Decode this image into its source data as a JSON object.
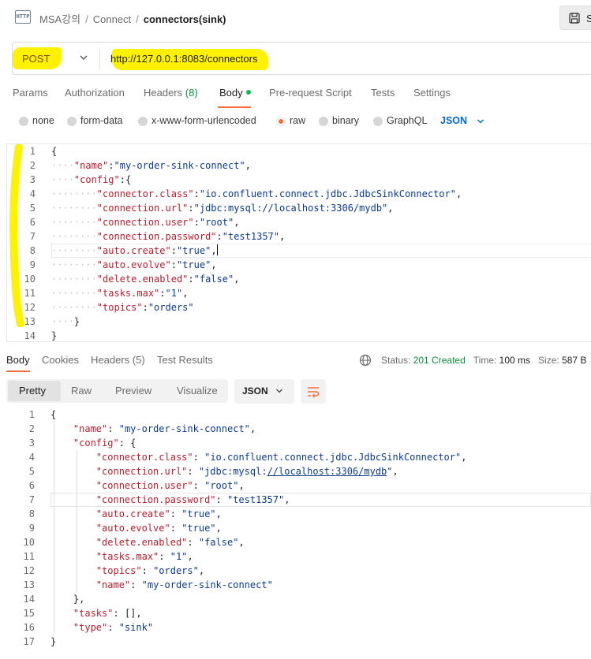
{
  "header": {
    "breadcrumb": [
      "MSA강의",
      "Connect",
      "connectors(sink)"
    ],
    "save_label": "S",
    "http_icon_text": "HTTP"
  },
  "request": {
    "method": "POST",
    "url": "http://127.0.0.1:8083/connectors"
  },
  "request_tabs": [
    {
      "label": "Params"
    },
    {
      "label": "Authorization"
    },
    {
      "label": "Headers",
      "count": "(8)"
    },
    {
      "label": "Body",
      "active": true
    },
    {
      "label": "Pre-request Script"
    },
    {
      "label": "Tests"
    },
    {
      "label": "Settings"
    }
  ],
  "body_types": [
    "none",
    "form-data",
    "x-www-form-urlencoded",
    "raw",
    "binary",
    "GraphQL"
  ],
  "body_type_selected": "raw",
  "body_format": "JSON",
  "request_body_lines": [
    "{",
    "····\"name\":\"my-order-sink-connect\",",
    "····\"config\":{",
    "········\"connector.class\":\"io.confluent.connect.jdbc.JdbcSinkConnector\",",
    "········\"connection.url\":\"jdbc:mysql://localhost:3306/mydb\",",
    "········\"connection.user\":\"root\",",
    "········\"connection.password\":\"test1357\",",
    "········\"auto.create\":\"true\",",
    "········\"auto.evolve\":\"true\",",
    "········\"delete.enabled\":\"false\",",
    "········\"tasks.max\":\"1\",",
    "········\"topics\":\"orders\"",
    "····}",
    "}"
  ],
  "response_tabs": [
    {
      "label": "Body",
      "active": true
    },
    {
      "label": "Cookies"
    },
    {
      "label": "Headers",
      "count": "(5)"
    },
    {
      "label": "Test Results"
    }
  ],
  "response_status": {
    "status_label": "Status:",
    "status_value": "201 Created",
    "time_label": "Time:",
    "time_value": "100 ms",
    "size_label": "Size:",
    "size_value": "587 B"
  },
  "view_modes": [
    "Pretty",
    "Raw",
    "Preview",
    "Visualize"
  ],
  "view_mode_selected": "Pretty",
  "response_format": "JSON",
  "response_body_lines": [
    "{",
    "    \"name\": \"my-order-sink-connect\",",
    "    \"config\": {",
    "        \"connector.class\": \"io.confluent.connect.jdbc.JdbcSinkConnector\",",
    "        \"connection.url\": \"jdbc:mysql://localhost:3306/mydb\",",
    "        \"connection.user\": \"root\",",
    "        \"connection.password\": \"test1357\",",
    "        \"auto.create\": \"true\",",
    "        \"auto.evolve\": \"true\",",
    "        \"delete.enabled\": \"false\",",
    "        \"tasks.max\": \"1\",",
    "        \"topics\": \"orders\",",
    "        \"name\": \"my-order-sink-connect\"",
    "    },",
    "    \"tasks\": [],",
    "    \"type\": \"sink\"",
    "}"
  ],
  "colors": {
    "accent": "#ff6c37",
    "highlighter": "#fff200",
    "json_key": "#b61e2e",
    "json_string": "#0d3a8c",
    "status_ok": "#0a8f3a",
    "link": "#0265d2"
  }
}
